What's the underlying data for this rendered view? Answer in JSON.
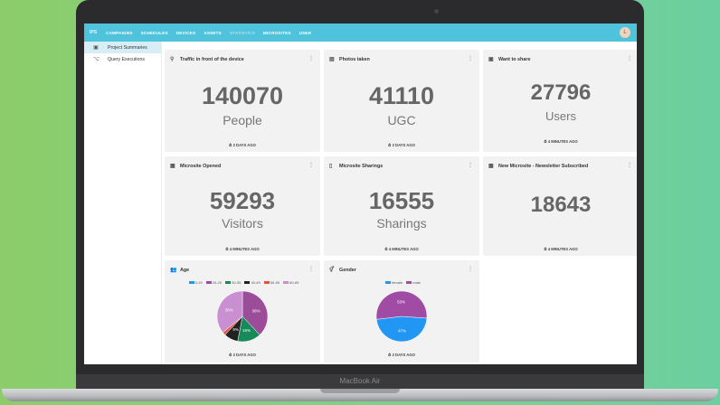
{
  "device": {
    "label": "MacBook Air"
  },
  "nav": {
    "logo": "IPS",
    "items": [
      "CAMPAIGNS",
      "SCHEDULES",
      "DEVICES",
      "ASSETS",
      "STATISTICS",
      "MICROSITES",
      "USER"
    ],
    "avatar": "L"
  },
  "sidebar": {
    "items": [
      {
        "label": "Project Summaries",
        "icon": "dashboard-icon"
      },
      {
        "label": "Query Executions",
        "icon": "query-icon"
      }
    ]
  },
  "cards": [
    {
      "title": "Traffic in front of the device",
      "value": "140070",
      "unit": "People",
      "updated": "2 DAYS AGO"
    },
    {
      "title": "Photos taken",
      "value": "41110",
      "unit": "UGC",
      "updated": "2 DAYS AGO"
    },
    {
      "title": "Want to share",
      "value": "27796",
      "unit": "Users",
      "updated": "4 MINUTES AGO"
    },
    {
      "title": "Microsite Opened",
      "value": "59293",
      "unit": "Visitors",
      "updated": "4 MINUTES AGO"
    },
    {
      "title": "Microsite Sharings",
      "value": "16555",
      "unit": "Sharings",
      "updated": "4 MINUTES AGO"
    },
    {
      "title": "New Microsite - Newsletter Subscribed",
      "value": "18643",
      "unit": "",
      "updated": "4 MINUTES AGO"
    }
  ],
  "age_card": {
    "title": "Age",
    "updated": "2 DAYS AGO"
  },
  "gender_card": {
    "title": "Gender",
    "updated": "2 DAYS AGO"
  },
  "colors": {
    "topbar": "#4fc3dc",
    "card": "#f2f2f2",
    "active": "#d7eef6"
  },
  "chart_data": [
    {
      "type": "pie",
      "title": "Age",
      "categories": [
        "0-19",
        "20-29",
        "30-39",
        "40-49",
        "50-59",
        "60-69"
      ],
      "values": [
        0,
        38,
        15,
        9,
        2,
        36
      ],
      "colors": [
        "#2196f3",
        "#9c4d9a",
        "#178a5a",
        "#222222",
        "#e0533c",
        "#c98fd1"
      ],
      "labels": [
        "",
        "38%",
        "15%",
        "9%",
        "",
        "36%"
      ],
      "legend": "top"
    },
    {
      "type": "pie",
      "title": "Gender",
      "categories": [
        "female",
        "male"
      ],
      "values": [
        47,
        53
      ],
      "colors": [
        "#2196f3",
        "#a04ca4"
      ],
      "labels": [
        "47%",
        "53%"
      ],
      "legend": "top"
    }
  ]
}
